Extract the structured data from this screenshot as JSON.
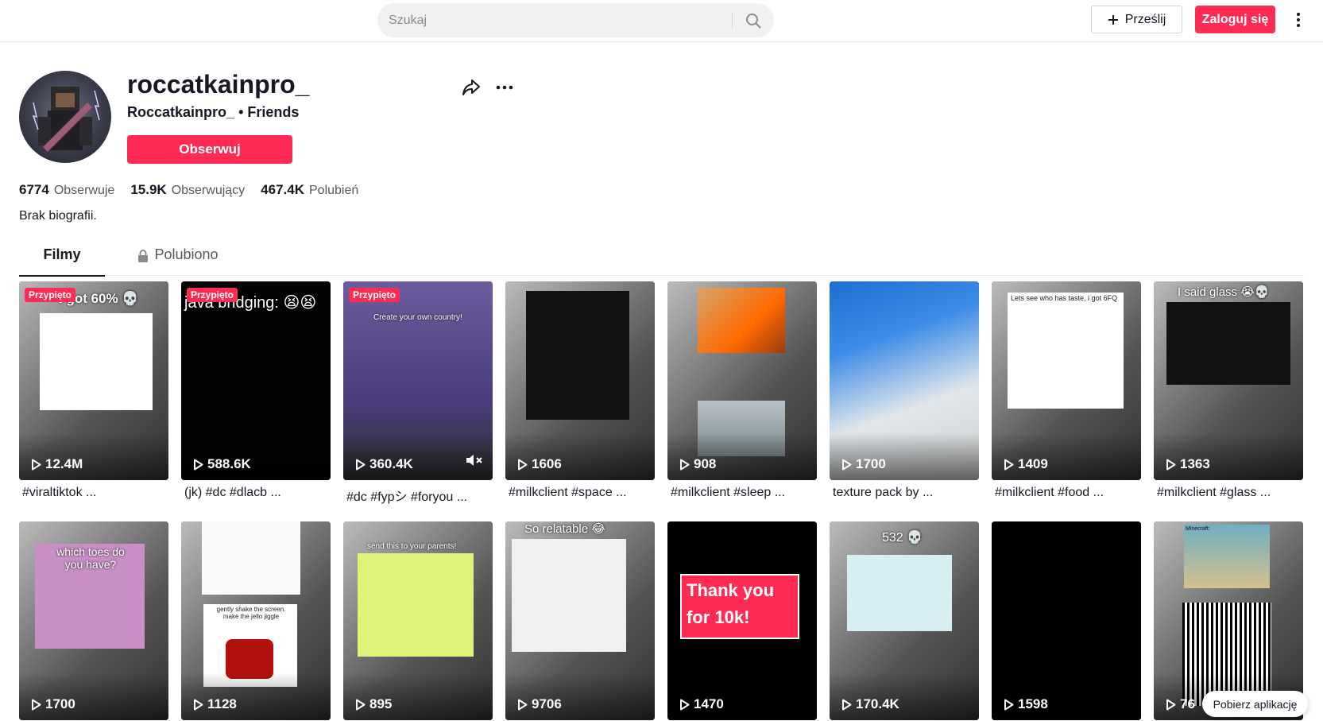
{
  "header": {
    "search_placeholder": "Szukaj",
    "upload_label": "Prześlij",
    "login_label": "Zaloguj się"
  },
  "profile": {
    "username": "roccatkainpro_",
    "nickname": "Roccatkainpro_",
    "friends_label": "• Friends",
    "follow_label": "Obserwuj",
    "following_count": "6774",
    "following_label": "Obserwuje",
    "followers_count": "15.9K",
    "followers_label": "Obserwujący",
    "likes_count": "467.4K",
    "likes_label": "Polubień",
    "bio": "Brak biografii."
  },
  "tabs": {
    "videos": "Filmy",
    "liked": "Polubiono"
  },
  "pinned_label": "Przypięto",
  "videos": [
    {
      "views": "12.4M",
      "caption": "#viraltiktok ...",
      "tag": true,
      "pinned": true,
      "overlay": "I got 60% 💀"
    },
    {
      "views": "588.6K",
      "caption": "(jk) #dc #dlacb ...",
      "tag": false,
      "pinned": true,
      "overlay": "java bridging: 😫😫"
    },
    {
      "views": "360.4K",
      "caption": "#dc #fypシ #foryou ...",
      "tag": true,
      "pinned": true,
      "overlay": "Create your own country!"
    },
    {
      "views": "1606",
      "caption": "#milkclient #space ...",
      "tag": true,
      "pinned": false,
      "overlay": ""
    },
    {
      "views": "908",
      "caption": "#milkclient #sleep ...",
      "tag": true,
      "pinned": false,
      "overlay": ""
    },
    {
      "views": "1700",
      "caption": "texture pack by ...",
      "tag": false,
      "pinned": false,
      "overlay": ""
    },
    {
      "views": "1409",
      "caption": "#milkclient #food ...",
      "tag": true,
      "pinned": false,
      "overlay": "Lets see who has taste, i got 6FQ"
    },
    {
      "views": "1363",
      "caption": "#milkclient #glass ...",
      "tag": true,
      "pinned": false,
      "overlay": "I said glass 😭💀"
    },
    {
      "views": "1700",
      "caption": "",
      "tag": false,
      "pinned": false,
      "overlay": "which toes do you have?"
    },
    {
      "views": "1128",
      "caption": "",
      "tag": false,
      "pinned": false,
      "overlay": "gently shake the screen. make the jello jiggle"
    },
    {
      "views": "895",
      "caption": "",
      "tag": false,
      "pinned": false,
      "overlay": "send this to your parents!"
    },
    {
      "views": "9706",
      "caption": "",
      "tag": false,
      "pinned": false,
      "overlay": "So relatable 😂"
    },
    {
      "views": "1470",
      "caption": "",
      "tag": false,
      "pinned": false,
      "overlay": "Thank you for 10k!"
    },
    {
      "views": "170.4K",
      "caption": "",
      "tag": false,
      "pinned": false,
      "overlay": "532 💀"
    },
    {
      "views": "1598",
      "caption": "",
      "tag": false,
      "pinned": false,
      "overlay": ""
    },
    {
      "views": "76",
      "caption": "",
      "tag": false,
      "pinned": false,
      "overlay": "Minecraft:"
    }
  ],
  "download_app_label": "Pobierz aplikację",
  "colors": {
    "accent": "#fe2c55",
    "hashtag": "#2b5db9"
  }
}
